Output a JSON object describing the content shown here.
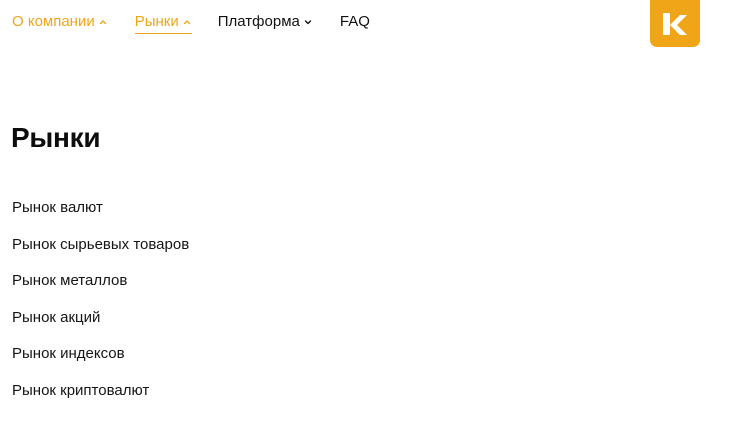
{
  "nav": {
    "items": [
      {
        "label": "О компании",
        "chevron": "up",
        "active": true
      },
      {
        "label": "Рынки",
        "chevron": "up",
        "active": true,
        "current": true
      },
      {
        "label": "Платформа",
        "chevron": "down",
        "active": false
      },
      {
        "label": "FAQ",
        "active": false
      }
    ]
  },
  "logo": {
    "icon": "k-logo-icon",
    "color": "#f0a519"
  },
  "page": {
    "title": "Рынки"
  },
  "markets": [
    "Рынок валют",
    "Рынок сырьевых товаров",
    "Рынок металлов",
    "Рынок акций",
    "Рынок индексов",
    "Рынок криптовалют"
  ],
  "colors": {
    "accent": "#f0a519",
    "text": "#111111",
    "background": "#ffffff"
  }
}
